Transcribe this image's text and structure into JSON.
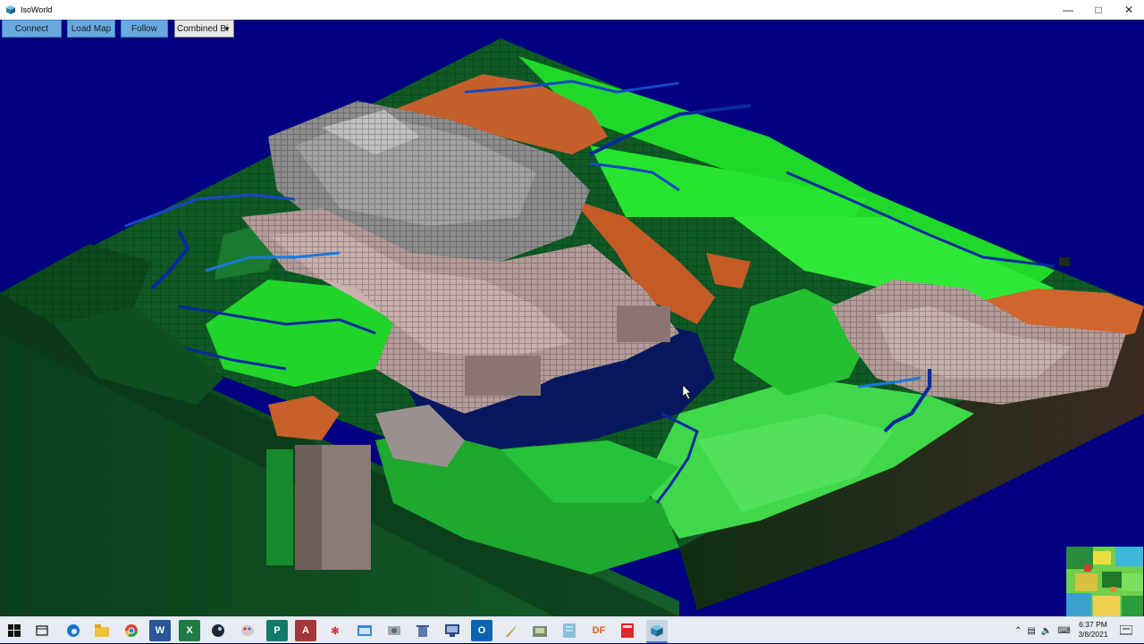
{
  "window": {
    "title": "IsoWorld",
    "icon": "isoworld-cube-icon",
    "controls": [
      "minimize-icon",
      "maximize-icon",
      "close-icon"
    ]
  },
  "toolbar": {
    "connect_label": "Connect",
    "load_map_label": "Load Map",
    "follow_label": "Follow",
    "view_mode_value": "Combined Bi",
    "accent_color": "#6aa9e0"
  },
  "viewport": {
    "background_color": "#000080",
    "terrain_colors": {
      "grass_bright": "#21e021",
      "grass_mid": "#1a9c2a",
      "grass_dark": "#0c5a22",
      "rock_pink": "#b8a0a0",
      "rock_gray": "#8c8c8c",
      "dirt_orange": "#c8602a",
      "water": "#0a1a80",
      "river": "#1040c0"
    },
    "minimap_icon": "minimap"
  },
  "taskbar": {
    "apps": [
      "windows-start-icon",
      "task-view-icon",
      "edge-icon",
      "file-explorer-icon",
      "chrome-icon",
      "word-icon",
      "excel-icon",
      "steam-icon",
      "paint-icon",
      "publisher-icon",
      "access-icon",
      "acrobat-icon",
      "app-window-icon",
      "disk-icon",
      "trash-icon",
      "settings-window-icon",
      "outlook-icon",
      "sword-icon",
      "game-icon",
      "notebook-icon",
      "df-label",
      "red-book-icon",
      "isoworld-taskbar-icon"
    ],
    "df_text": "DF",
    "clock_time": "6:37 PM",
    "clock_date": "3/8/2021"
  }
}
